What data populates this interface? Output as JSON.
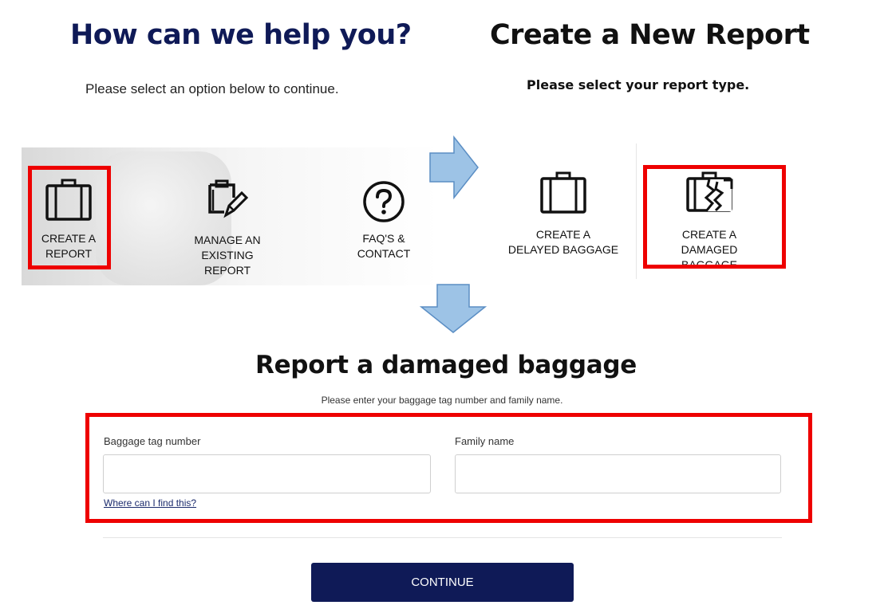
{
  "help": {
    "title": "How can we help you?",
    "subtitle": "Please select an option below to continue.",
    "options": [
      {
        "line1": "CREATE A",
        "line2": "REPORT",
        "icon": "suitcase-icon"
      },
      {
        "line1": "MANAGE AN",
        "line2": "EXISTING REPORT",
        "icon": "clipboard-edit-icon"
      },
      {
        "line1": "FAQ'S &",
        "line2": "CONTACT",
        "icon": "question-circle-icon"
      }
    ]
  },
  "create": {
    "title": "Create a New Report",
    "subtitle": "Please select your report type.",
    "options": [
      {
        "line1": "CREATE A",
        "line2": "DELAYED BAGGAGE",
        "icon": "suitcase-icon"
      },
      {
        "line1": "CREATE A",
        "line2": "DAMAGED BAGGAGE",
        "icon": "damaged-suitcase-icon"
      }
    ]
  },
  "report": {
    "title": "Report a damaged baggage",
    "subtitle": "Please enter your baggage tag number and family name.",
    "tag_label": "Baggage tag number",
    "tag_value": "",
    "family_label": "Family name",
    "family_value": "",
    "help_link": "Where can I find this?",
    "continue_label": "CONTINUE"
  },
  "colors": {
    "brand_navy": "#0f1a57",
    "highlight_red": "#ee0000",
    "arrow_blue": "#9dc3e6"
  }
}
